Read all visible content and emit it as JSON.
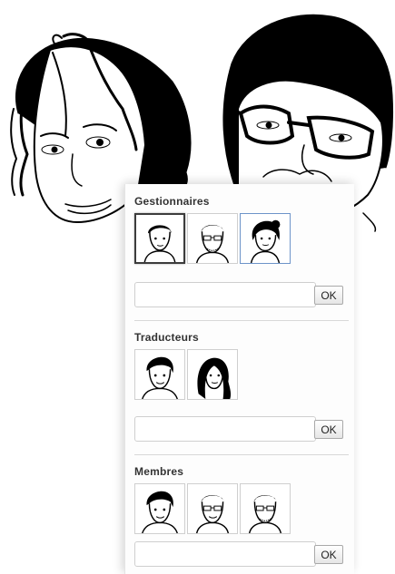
{
  "sections": [
    {
      "title": "Gestionnaires",
      "avatars": [
        "man-short-hair-portrait",
        "man-glasses-beard-portrait",
        "woman-curly-hair-portrait"
      ],
      "selected": 0,
      "hover": 2,
      "input_value": "",
      "ok_label": "OK"
    },
    {
      "title": "Traducteurs",
      "avatars": [
        "young-man-portrait",
        "woman-long-hair-portrait"
      ],
      "input_value": "",
      "ok_label": "OK"
    },
    {
      "title": "Membres",
      "avatars": [
        "young-man-portrait",
        "man-glasses-beard-portrait",
        "man-glasses-beard-portrait"
      ],
      "input_value": "",
      "ok_label": "OK"
    }
  ]
}
